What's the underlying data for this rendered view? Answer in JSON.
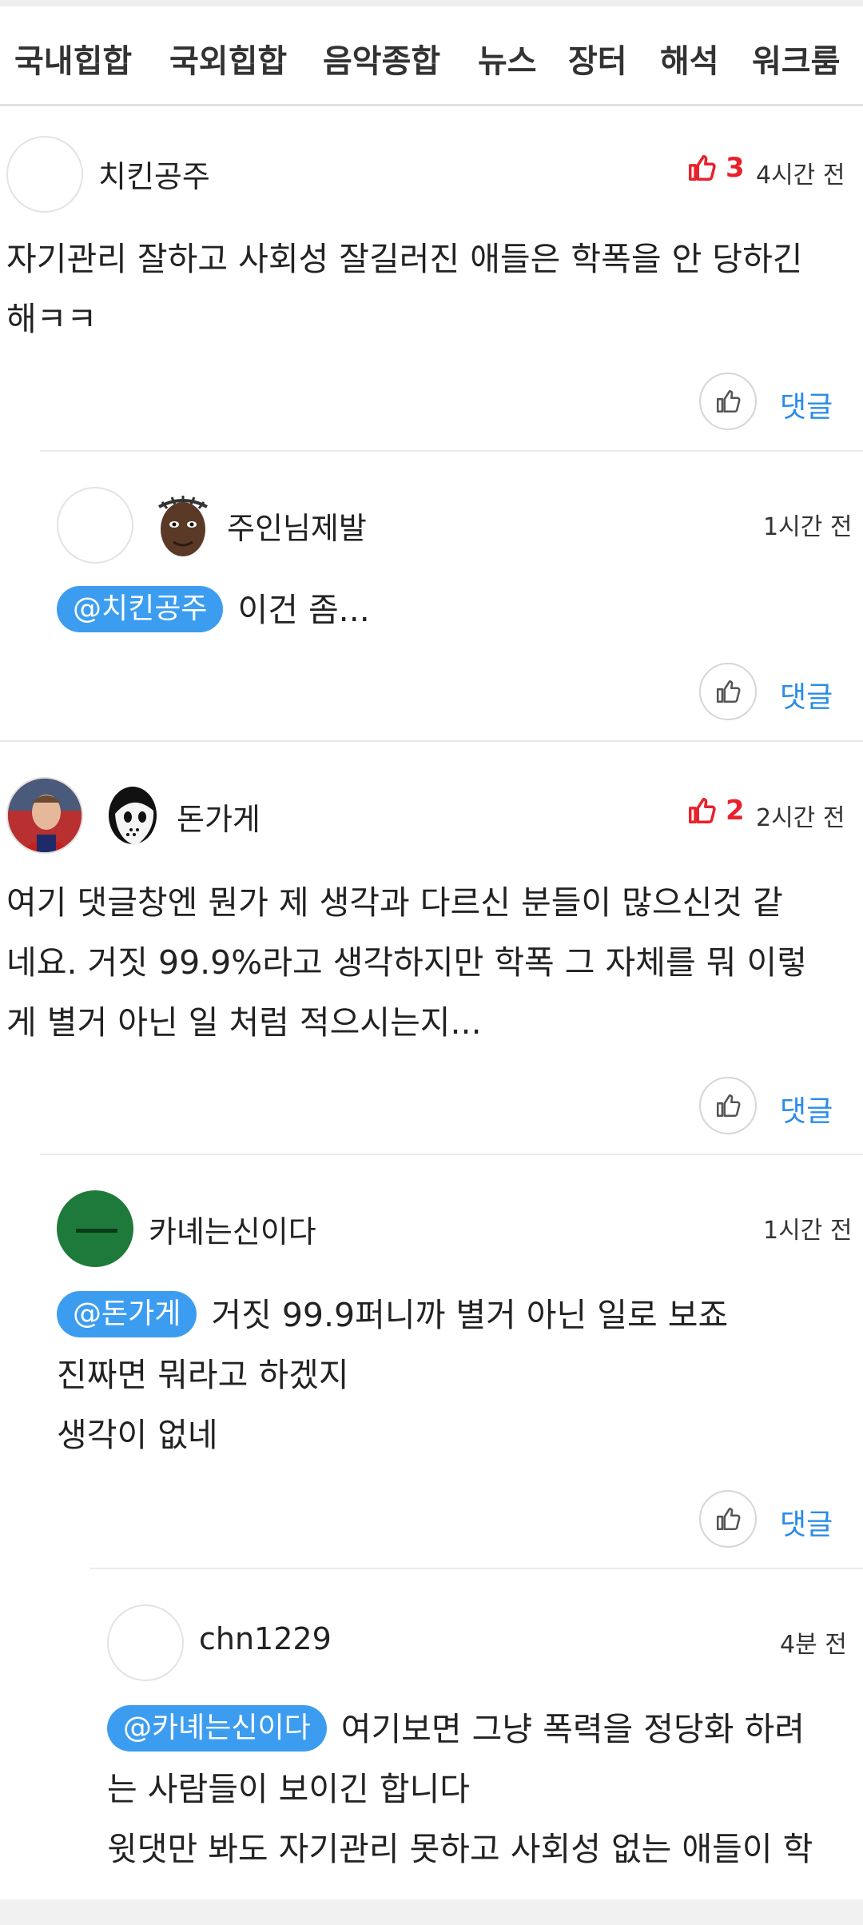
{
  "tabs": [
    "국내힙합",
    "국외힙합",
    "음악종합",
    "뉴스",
    "장터",
    "해석",
    "워크룸"
  ],
  "colors": {
    "accent_blue": "#3c9df0",
    "like_red": "#e8222c",
    "reply_blue": "#2b8ce6"
  },
  "comments": [
    {
      "username": "치킨공주",
      "likes": "3",
      "time": "4시간 전",
      "lines": [
        "자기관리 잘하고 사회성 잘길러진 애들은 학폭을 안 당하긴",
        "해ㅋㅋ"
      ],
      "reply_label": "댓글"
    },
    {
      "username": "주인님제발",
      "time": "1시간 전",
      "mention": "@치킨공주",
      "lines": [
        "이건 좀..."
      ],
      "reply_label": "댓글"
    },
    {
      "username": "돈가게",
      "likes": "2",
      "time": "2시간 전",
      "lines": [
        "여기 댓글창엔 뭔가 제 생각과 다르신 분들이 많으신것 같",
        "네요. 거짓 99.9%라고 생각하지만 학폭 그 자체를 뭐 이렇",
        "게 별거 아닌 일 처럼 적으시는지..."
      ],
      "reply_label": "댓글"
    },
    {
      "username": "카녜는신이다",
      "time": "1시간 전",
      "mention": "@돈가게",
      "lines": [
        "거짓 99.9퍼니까 별거 아닌 일로 보죠",
        "진짜면 뭐라고 하겠지",
        "생각이 없네"
      ],
      "reply_label": "댓글"
    },
    {
      "username": "chn1229",
      "time": "4분 전",
      "mention": "@카녜는신이다",
      "lines": [
        "여기보면 그냥 폭력을 정당화 하려",
        "는 사람들이 보이긴 합니다",
        "윗댓만 봐도 자기관리 못하고 사회성 없는 애들이 학"
      ]
    }
  ]
}
